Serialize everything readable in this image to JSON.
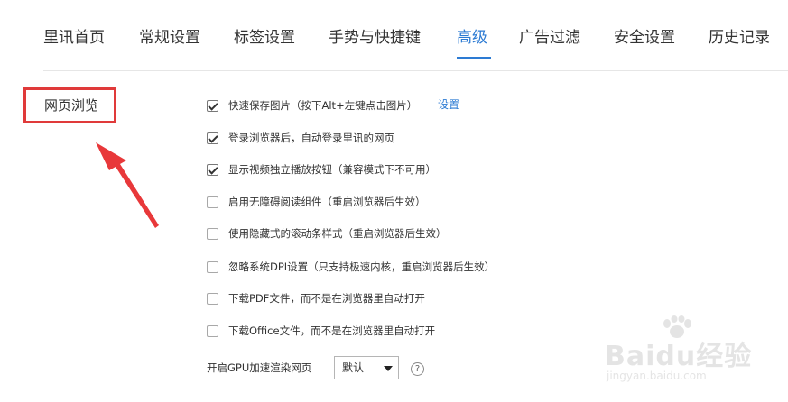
{
  "tabs": [
    {
      "label": "里讯首页",
      "active": false
    },
    {
      "label": "常规设置",
      "active": false
    },
    {
      "label": "标签设置",
      "active": false
    },
    {
      "label": "手势与快捷键",
      "active": false
    },
    {
      "label": "高级",
      "active": true
    },
    {
      "label": "广告过滤",
      "active": false
    },
    {
      "label": "安全设置",
      "active": false
    },
    {
      "label": "历史记录",
      "active": false
    }
  ],
  "section": {
    "label": "网页浏览"
  },
  "options": [
    {
      "label": "快速保存图片（按下Alt+左键点击图片）",
      "checked": true
    },
    {
      "label": "登录浏览器后，自动登录里讯的网页",
      "checked": true
    },
    {
      "label": "显示视频独立播放按钮（兼容模式下不可用）",
      "checked": true
    },
    {
      "label": "启用无障碍阅读组件（重启浏览器后生效）",
      "checked": false
    },
    {
      "label": "使用隐藏式的滚动条样式（重启浏览器后生效）",
      "checked": false
    },
    {
      "label": "忽略系统DPI设置（只支持极速内核，重启浏览器后生效）",
      "checked": false
    },
    {
      "label": "下载PDF文件，而不是在浏览器里自动打开",
      "checked": false
    },
    {
      "label": "下载Office文件，而不是在浏览器里自动打开",
      "checked": false
    }
  ],
  "settings_link": "设置",
  "gpu": {
    "label": "开启GPU加速渲染网页",
    "selected": "默认",
    "help": "?"
  },
  "watermark": {
    "brand": "Bai",
    "brand2": "经验",
    "url": "jingyan.baidu.com"
  },
  "colors": {
    "accent": "#2d7bd3",
    "highlight": "#e03a3a"
  }
}
